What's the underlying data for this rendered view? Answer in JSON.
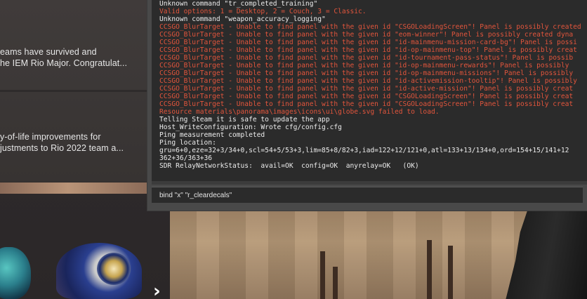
{
  "news": {
    "item1_lines": [
      "eams have survived and",
      "he IEM Rio Major. Congratulat..."
    ],
    "item2_lines": [
      "y-of-life improvements for",
      "justments to Rio 2022 team a..."
    ]
  },
  "carousel": {
    "next_arrow": "›"
  },
  "console": {
    "lines": [
      {
        "text": "Unknown command \"tr_completed_training\"",
        "error": false
      },
      {
        "text": "Valid options: 1 = Desktop, 2 = Couch, 3 = Classic.",
        "error": true
      },
      {
        "text": "Unknown command \"weapon_accuracy_logging\"",
        "error": false
      },
      {
        "text": "CCSGO_BlurTarget - Unable to find panel with the given id \"CSGOLoadingScreen\"! Panel is possibly created",
        "error": true
      },
      {
        "text": "CCSGO_BlurTarget - Unable to find panel with the given id \"eom-winner\"! Panel is possibly created dyna",
        "error": true
      },
      {
        "text": "CCSGO_BlurTarget - Unable to find panel with the given id \"id-mainmenu-mission-card-bg\"! Panel is possi",
        "error": true
      },
      {
        "text": "CCSGO_BlurTarget - Unable to find panel with the given id \"id-op-mainmenu-top\"! Panel is possibly creat",
        "error": true
      },
      {
        "text": "CCSGO_BlurTarget - Unable to find panel with the given id \"id-tournament-pass-status\"! Panel is possib",
        "error": true
      },
      {
        "text": "CCSGO_BlurTarget - Unable to find panel with the given id \"id-op-mainmenu-rewards\"! Panel is possibly",
        "error": true
      },
      {
        "text": "CCSGO_BlurTarget - Unable to find panel with the given id \"id-op-mainmenu-missions\"! Panel is possibly",
        "error": true
      },
      {
        "text": "CCSGO_BlurTarget - Unable to find panel with the given id \"id-activemission-tooltip\"! Panel is possibly",
        "error": true
      },
      {
        "text": "CCSGO_BlurTarget - Unable to find panel with the given id \"id-active-mission\"! Panel is possibly creat",
        "error": true
      },
      {
        "text": "CCSGO_BlurTarget - Unable to find panel with the given id \"CSGOLoadingScreen\"! Panel is possibly creat",
        "error": true
      },
      {
        "text": "CCSGO_BlurTarget - Unable to find panel with the given id \"CSGOLoadingScreen\"! Panel is possibly creat",
        "error": true
      },
      {
        "text": "Resource materials\\panorama\\images\\icons\\ui\\globe.svg failed to load.",
        "error": true
      },
      {
        "text": "Telling Steam it is safe to update the app",
        "error": false
      },
      {
        "text": "Host_WriteConfiguration: Wrote cfg/config.cfg",
        "error": false
      },
      {
        "text": "Ping measurement completed",
        "error": false
      },
      {
        "text": "Ping location:",
        "error": false
      },
      {
        "text": "gru=6+0,eze=32+3/34+0,scl=54+5/53+3,lim=85+8/82+3,iad=122+12/121+0,atl=133+13/134+0,ord=154+15/141+12",
        "error": false
      },
      {
        "text": "362+36/363+36",
        "error": false
      },
      {
        "text": "SDR RelayNetworkStatus:  avail=OK  config=OK  anyrelay=OK   (OK)",
        "error": false
      }
    ],
    "input_value": "bind \"x\" \"r_cleardecals\""
  },
  "colors": {
    "error_text": "#e2553c",
    "normal_text": "#ececec",
    "console_bg": "#2b2b2b"
  }
}
